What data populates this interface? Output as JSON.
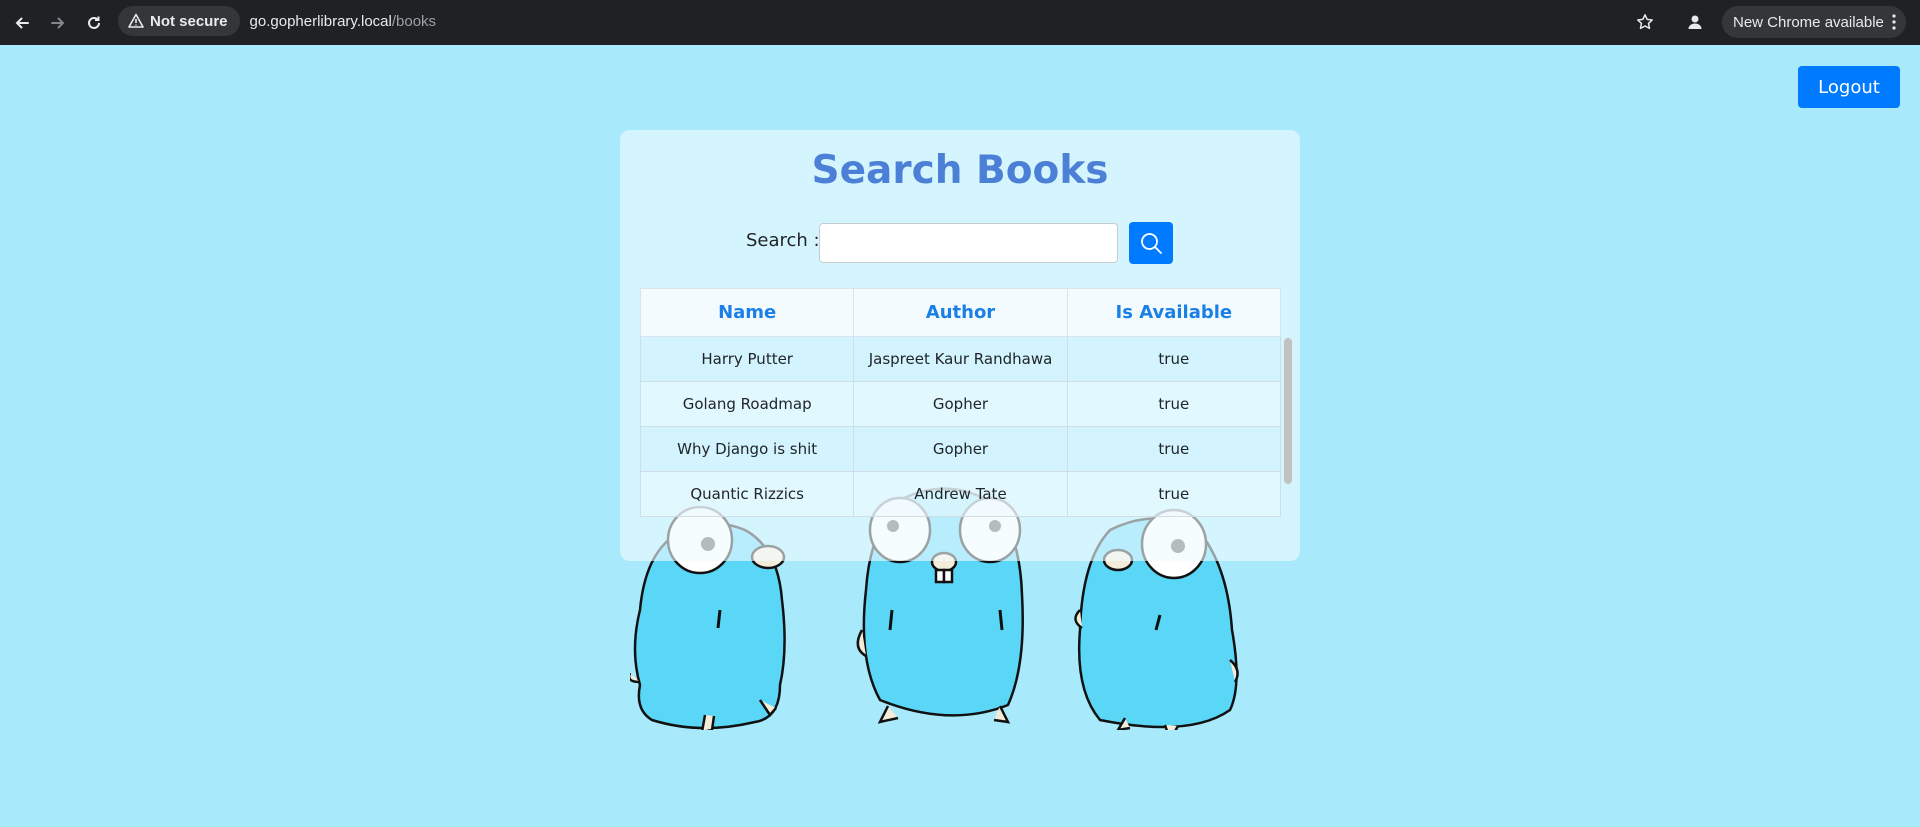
{
  "browser": {
    "security_label": "Not secure",
    "url_host": "go.gopherlibrary.local",
    "url_path": "/books",
    "update_label": "New Chrome available"
  },
  "page": {
    "logout_label": "Logout",
    "title": "Search Books",
    "search_label": "Search :",
    "search_value": "",
    "columns": [
      "Name",
      "Author",
      "Is Available"
    ],
    "rows": [
      {
        "name": "Harry Putter",
        "author": "Jaspreet Kaur Randhawa",
        "available": "true"
      },
      {
        "name": "Golang Roadmap",
        "author": "Gopher",
        "available": "true"
      },
      {
        "name": "Why Django is shit",
        "author": "Gopher",
        "available": "true"
      },
      {
        "name": "Quantic Rizzics",
        "author": "Andrew Tate",
        "available": "true"
      }
    ]
  },
  "colors": {
    "page_bg": "#a9e9fc",
    "accent": "#007bff",
    "title": "#4b80d6",
    "header_text": "#1a80e6",
    "gopher_body": "#5ad6f7"
  },
  "icons": {
    "back": "arrow-left-icon",
    "forward": "arrow-right-icon",
    "reload": "reload-icon",
    "warning": "warning-triangle-icon",
    "bookmark": "star-icon",
    "profile": "person-icon",
    "menu": "kebab-menu-icon",
    "search": "magnifier-icon"
  }
}
